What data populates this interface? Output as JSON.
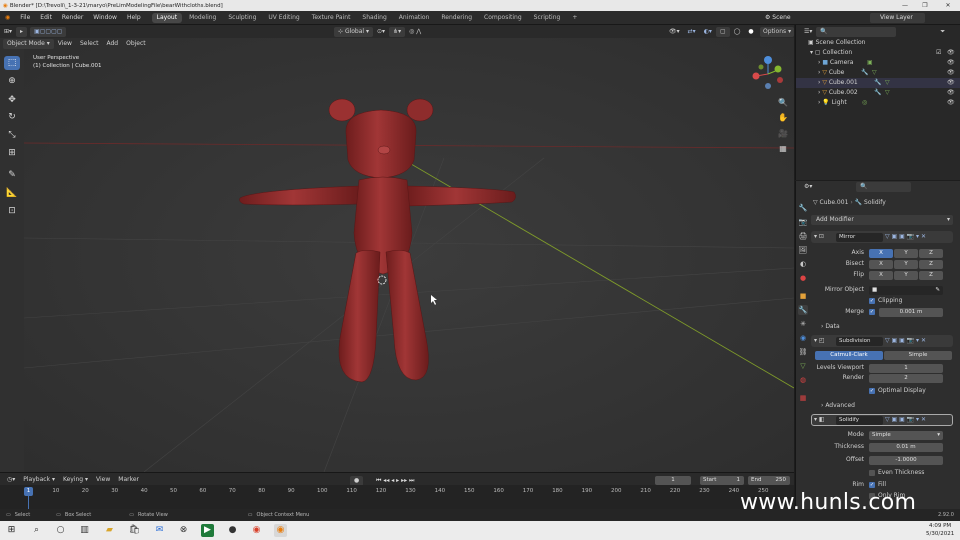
{
  "titlebar": {
    "title": "Blender* [D:\\Trevoli\\_1-3-21\\maryo\\PreLimModelingFile\\bearWithcloths.blend]",
    "min": "—",
    "max": "❐",
    "close": "✕"
  },
  "menu": [
    "File",
    "Edit",
    "Render",
    "Window",
    "Help"
  ],
  "workspaces": [
    "Layout",
    "Modeling",
    "Sculpting",
    "UV Editing",
    "Texture Paint",
    "Shading",
    "Animation",
    "Rendering",
    "Compositing",
    "Scripting"
  ],
  "add_workspace": "+",
  "scene": "Scene",
  "view_layer": "View Layer",
  "viewport_header": {
    "mode": "Object Mode",
    "menus": [
      "View",
      "Select",
      "Add",
      "Object"
    ],
    "orientation": "Global",
    "options": "Options"
  },
  "viewport": {
    "perspective": "User Perspective",
    "collection": "(1) Collection | Cube.001"
  },
  "outliner": {
    "root": "Scene Collection",
    "collection": "Collection",
    "items": [
      {
        "name": "Camera",
        "icon": "camera-icon",
        "color": "#6ea6d6"
      },
      {
        "name": "Cube",
        "icon": "mesh-icon",
        "color": "#e3a13a"
      },
      {
        "name": "Cube.001",
        "icon": "mesh-icon",
        "color": "#e3a13a"
      },
      {
        "name": "Cube.002",
        "icon": "mesh-icon",
        "color": "#e3a13a"
      },
      {
        "name": "Light",
        "icon": "light-icon",
        "color": "#e3a13a"
      }
    ]
  },
  "properties": {
    "object": "Cube.001",
    "modifier_tab": "Solidify",
    "add_modifier": "Add Modifier",
    "mirror": {
      "name": "Mirror",
      "axis_label": "Axis",
      "bisect_label": "Bisect",
      "flip_label": "Flip",
      "x": "X",
      "y": "Y",
      "z": "Z",
      "mirror_object": "Mirror Object",
      "clipping": "Clipping",
      "merge": "Merge",
      "merge_value": "0.001 m",
      "data": "Data"
    },
    "subdivision": {
      "name": "Subdivision",
      "catmull": "Catmull-Clark",
      "simple": "Simple",
      "levels_viewport": "Levels Viewport",
      "levels_value": "1",
      "render": "Render",
      "render_value": "2",
      "optimal": "Optimal Display",
      "advanced": "Advanced"
    },
    "solidify": {
      "name": "Solidify",
      "mode_label": "Mode",
      "mode": "Simple",
      "thickness_label": "Thickness",
      "thickness": "0.01 m",
      "offset_label": "Offset",
      "offset": "-1.0000",
      "even": "Even Thickness",
      "rim": "Rim",
      "fill": "Fill",
      "only_rim": "Only Rim"
    }
  },
  "timeline": {
    "menus": [
      "Playback",
      "Keying",
      "View",
      "Marker"
    ],
    "current": "1",
    "start_label": "Start",
    "start": "1",
    "end_label": "End",
    "end": "250",
    "ticks": [
      "0",
      "10",
      "20",
      "30",
      "40",
      "50",
      "60",
      "70",
      "80",
      "90",
      "100",
      "110",
      "120",
      "130",
      "140",
      "150",
      "160",
      "170",
      "180",
      "190",
      "200",
      "210",
      "220",
      "230",
      "240",
      "250"
    ]
  },
  "statusbar": {
    "select": "Select",
    "box": "Box Select",
    "rotate": "Rotate View",
    "context": "Object Context Menu",
    "version": "2.92.0"
  },
  "taskbar": {
    "time": "4:09 PM",
    "date": "5/30/2021"
  },
  "watermark": "www.hunls.com",
  "colors": {
    "accent": "#4772b3",
    "bear": "#8e2a2a",
    "x_axis": "#7a2b2b",
    "y_axis": "#7e9a2a"
  }
}
